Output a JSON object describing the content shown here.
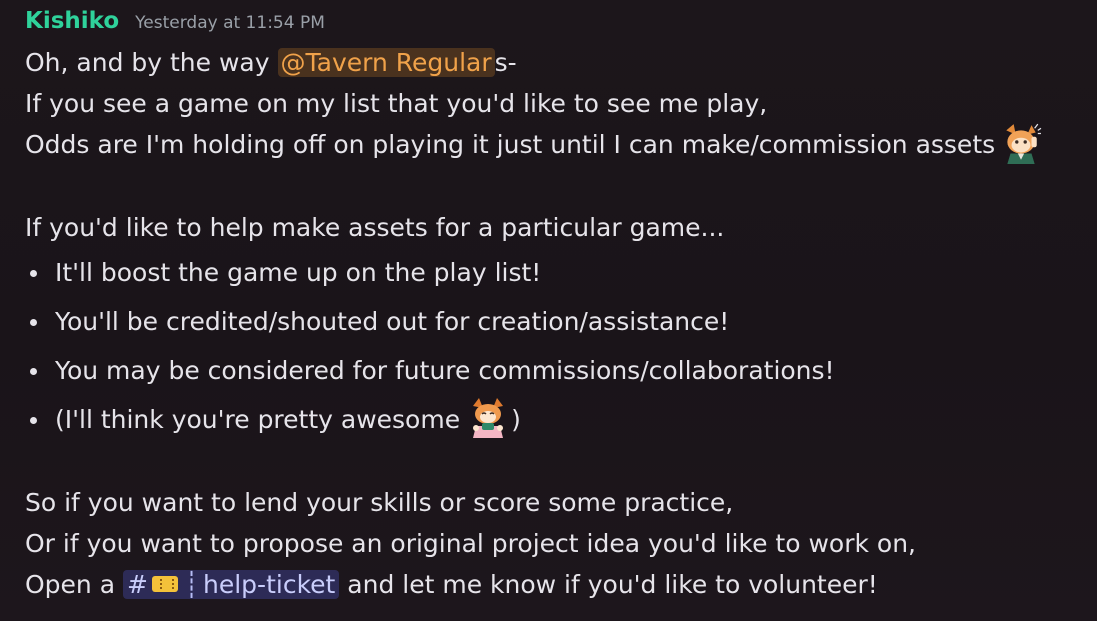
{
  "message": {
    "author": "Kishiko",
    "timestamp": "Yesterday at 11:54 PM",
    "line1_before": "Oh, and by the way ",
    "mention": "@Tavern Regular",
    "line1_after": "s-",
    "line2": "If you see a game on my list that you'd like to see me play,",
    "line3": "Odds are I'm holding off on playing it just until I can make/commission assets",
    "line4": "If you'd like to help make assets for a particular game...",
    "bullets": [
      "It'll boost the game up on the play list!",
      "You'll be credited/shouted out for creation/assistance!",
      "You may be considered for future commissions/collaborations!",
      "(I'll think you're pretty awesome"
    ],
    "bullet4_close": ")",
    "line5": "So if you want to lend your skills or score some practice,",
    "line6": "Or if you want to propose an original project idea you'd like to work on,",
    "line7_before": "Open a ",
    "channel_hash": "#",
    "channel_sep": "┊",
    "channel_name": "help-ticket",
    "line7_after": " and let me know if you'd like to volunteer!"
  },
  "emojis": {
    "fox_salute": "fox-salute-emoji",
    "fox_happy": "fox-happy-emoji",
    "ticket": "ticket-icon"
  },
  "colors": {
    "author": "#2fd29b",
    "mention_text": "#f0a24a",
    "channel_text": "#c9cdfb",
    "background": "#1a1419"
  }
}
